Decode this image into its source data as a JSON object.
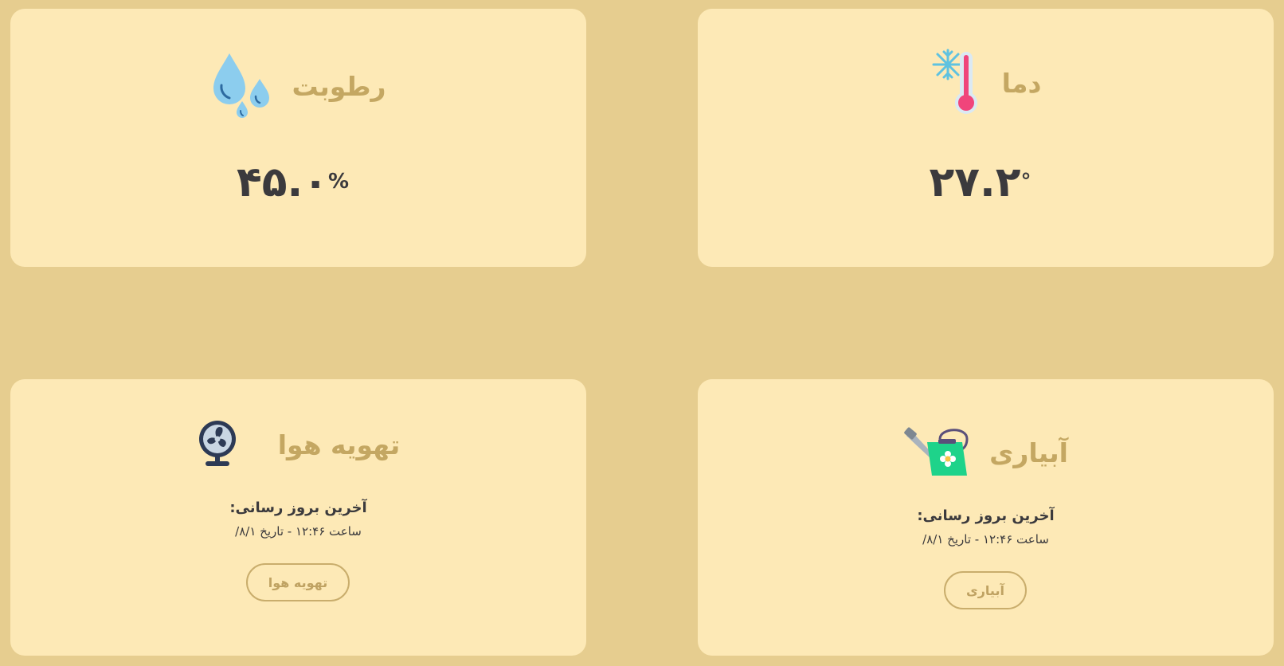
{
  "humidity": {
    "title": "رطوبت",
    "value": "۴۵.۰",
    "unit": "%",
    "icon": "water-drops-icon"
  },
  "temperature": {
    "title": "دما",
    "value": "۲۷.۲",
    "unit": "°",
    "icon": "thermometer-snowflake-icon"
  },
  "ventilation": {
    "title": "تهویه هوا",
    "last_update_label": "آخرین بروز رسانی:",
    "last_update_time": "ساعت ۱۲:۴۶ - تاریخ ۸/۱/",
    "button_label": "تهویه هوا",
    "icon": "fan-icon"
  },
  "irrigation": {
    "title": "آبیاری",
    "last_update_label": "آخرین بروز رسانی:",
    "last_update_time": "ساعت ۱۲:۴۶ - تاریخ ۸/۱/",
    "button_label": "آبیاری",
    "icon": "watering-can-icon"
  },
  "colors": {
    "background": "#e6cd8f",
    "card": "#fde9b6",
    "title": "#c4a762",
    "value": "#3b3a3d",
    "button_border": "#c9ad6c"
  }
}
